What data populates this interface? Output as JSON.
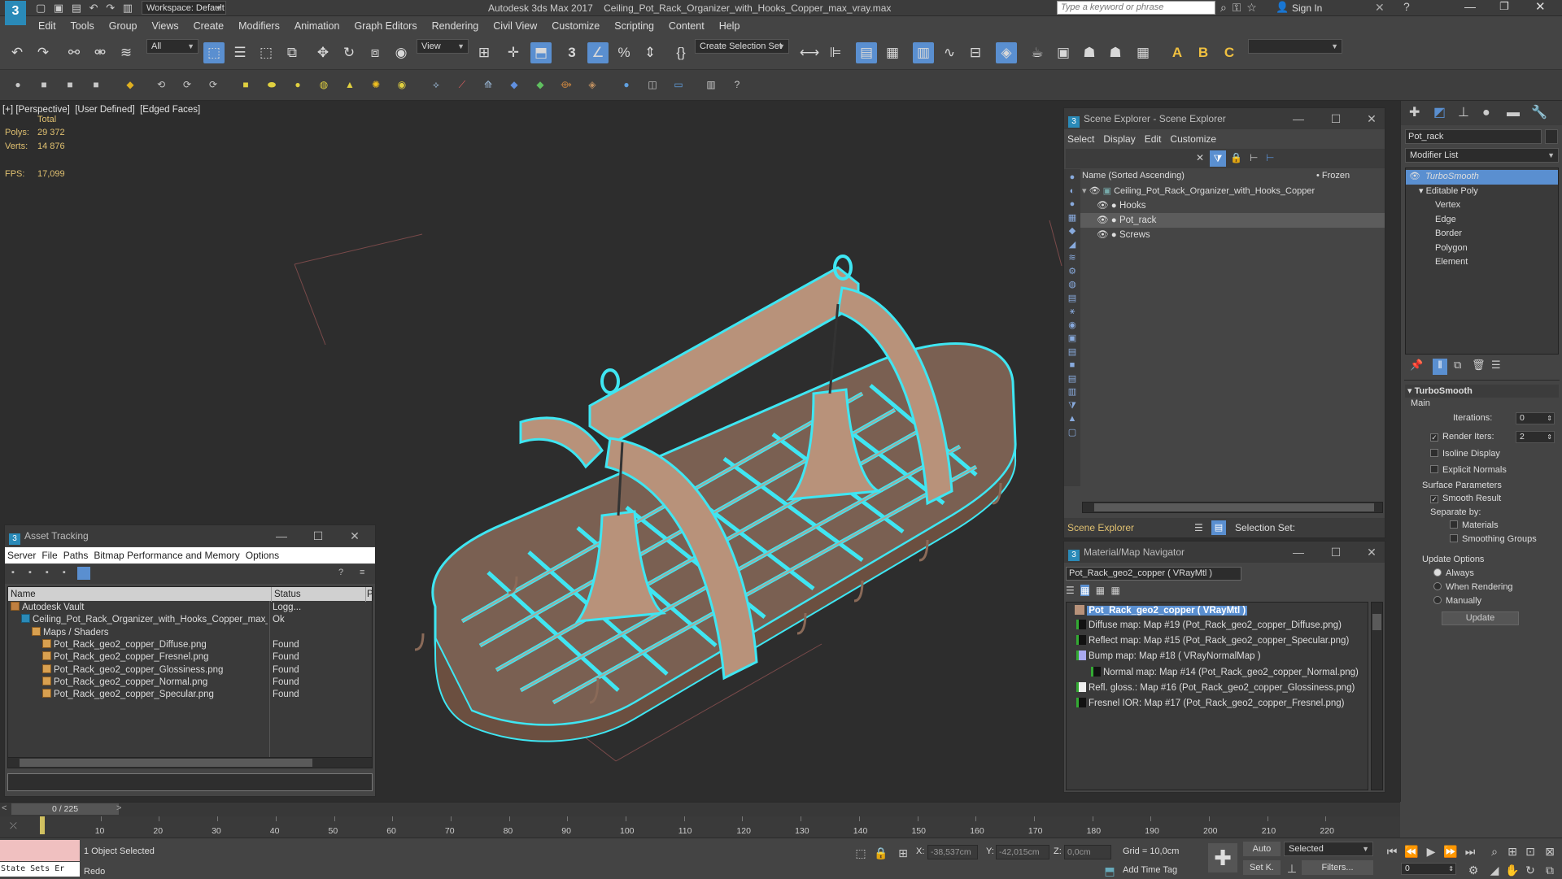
{
  "titlebar": {
    "workspace_label": "Workspace: Default",
    "app_title": "Autodesk 3ds Max 2017",
    "file_title": "Ceiling_Pot_Rack_Organizer_with_Hooks_Copper_max_vray.max",
    "search_placeholder": "Type a keyword or phrase",
    "sign_in": "Sign In"
  },
  "menu": [
    "Edit",
    "Tools",
    "Group",
    "Views",
    "Create",
    "Modifiers",
    "Animation",
    "Graph Editors",
    "Rendering",
    "Civil View",
    "Customize",
    "Scripting",
    "Content",
    "Help"
  ],
  "toolbar": {
    "filter_value": "All",
    "view_value": "View",
    "snap_label": "3",
    "named_selection_value": "Create Selection Set"
  },
  "viewport": {
    "labels": [
      "[+]",
      "[Perspective]",
      "[User Defined]",
      "[Edged Faces]"
    ],
    "stats": {
      "total_label": "Total",
      "polys_label": "Polys:",
      "polys_value": "29 372",
      "verts_label": "Verts:",
      "verts_value": "14 876",
      "fps_label": "FPS:",
      "fps_value": "17,099"
    }
  },
  "scene_explorer": {
    "title": "Scene Explorer - Scene Explorer",
    "menu": [
      "Select",
      "Display",
      "Edit",
      "Customize"
    ],
    "col_name": "Name (Sorted Ascending)",
    "col_frozen": "• Frozen",
    "root": "Ceiling_Pot_Rack_Organizer_with_Hooks_Copper",
    "children": [
      "Hooks",
      "Pot_rack",
      "Screws"
    ],
    "footer_name": "Scene Explorer",
    "footer_selset": "Selection Set:"
  },
  "material_navigator": {
    "title": "Material/Map Navigator",
    "current": "Pot_Rack_geo2_copper  ( VRayMtl )",
    "root": "Pot_Rack_geo2_copper  ( VRayMtl )",
    "maps": [
      "Diffuse map: Map #19 (Pot_Rack_geo2_copper_Diffuse.png)",
      "Reflect map: Map #15 (Pot_Rack_geo2_copper_Specular.png)",
      "Bump map: Map #18  ( VRayNormalMap )",
      "Normal map: Map #14 (Pot_Rack_geo2_copper_Normal.png)",
      "Refl. gloss.: Map #16 (Pot_Rack_geo2_copper_Glossiness.png)",
      "Fresnel IOR: Map #17 (Pot_Rack_geo2_copper_Fresnel.png)"
    ]
  },
  "asset_tracking": {
    "title": "Asset Tracking",
    "menu": [
      "Server",
      "File",
      "Paths",
      "Bitmap Performance and Memory",
      "Options"
    ],
    "col_name": "Name",
    "col_status": "Status",
    "col_p": "P",
    "rows": [
      {
        "name": "Autodesk Vault",
        "status": "Logg...",
        "indent": 0,
        "kind": "vault"
      },
      {
        "name": "Ceiling_Pot_Rack_Organizer_with_Hooks_Copper_max_vray.max",
        "status": "Ok",
        "indent": 1,
        "kind": "max"
      },
      {
        "name": "Maps / Shaders",
        "status": "",
        "indent": 2,
        "kind": "folder"
      },
      {
        "name": "Pot_Rack_geo2_copper_Diffuse.png",
        "status": "Found",
        "indent": 3,
        "kind": "file"
      },
      {
        "name": "Pot_Rack_geo2_copper_Fresnel.png",
        "status": "Found",
        "indent": 3,
        "kind": "file"
      },
      {
        "name": "Pot_Rack_geo2_copper_Glossiness.png",
        "status": "Found",
        "indent": 3,
        "kind": "file"
      },
      {
        "name": "Pot_Rack_geo2_copper_Normal.png",
        "status": "Found",
        "indent": 3,
        "kind": "file"
      },
      {
        "name": "Pot_Rack_geo2_copper_Specular.png",
        "status": "Found",
        "indent": 3,
        "kind": "file"
      }
    ]
  },
  "command_panel": {
    "object_name": "Pot_rack",
    "modifier_list": "Modifier List",
    "stack": [
      "TurboSmooth",
      "Editable Poly",
      "Vertex",
      "Edge",
      "Border",
      "Polygon",
      "Element"
    ],
    "rollout_title": "TurboSmooth",
    "main_label": "Main",
    "iterations_label": "Iterations:",
    "iterations_value": "0",
    "render_iters_label": "Render Iters:",
    "render_iters_value": "2",
    "isoline_label": "Isoline Display",
    "explicit_label": "Explicit Normals",
    "surface_label": "Surface Parameters",
    "smooth_result_label": "Smooth Result",
    "separate_label": "Separate by:",
    "materials_label": "Materials",
    "smoothing_groups_label": "Smoothing Groups",
    "update_options_label": "Update Options",
    "always_label": "Always",
    "when_rendering_label": "When Rendering",
    "manually_label": "Manually",
    "update_button": "Update"
  },
  "timeline": {
    "frame_display": "0 / 225",
    "ticks": [
      "10",
      "20",
      "30",
      "40",
      "50",
      "60",
      "70",
      "80",
      "90",
      "100",
      "110",
      "120",
      "130",
      "140",
      "150",
      "160",
      "170",
      "180",
      "190",
      "200",
      "210",
      "220"
    ]
  },
  "status": {
    "listener": "State Sets Er",
    "selection": "1 Object Selected",
    "prompt": "Redo",
    "x_label": "X:",
    "x_value": "-38,537cm",
    "y_label": "Y:",
    "y_value": "-42,015cm",
    "z_label": "Z:",
    "z_value": "0,0cm",
    "grid": "Grid = 10,0cm",
    "add_time_tag": "Add Time Tag",
    "auto": "Auto",
    "set_key": "Set K.",
    "selected": "Selected",
    "filters": "Filters...",
    "frame_value": "0"
  },
  "colors": {
    "accent": "#5a8fd0",
    "wire_highlight": "#3fe6f2",
    "copper": "#b8927a",
    "viewport_bg": "#2d2d2d"
  }
}
